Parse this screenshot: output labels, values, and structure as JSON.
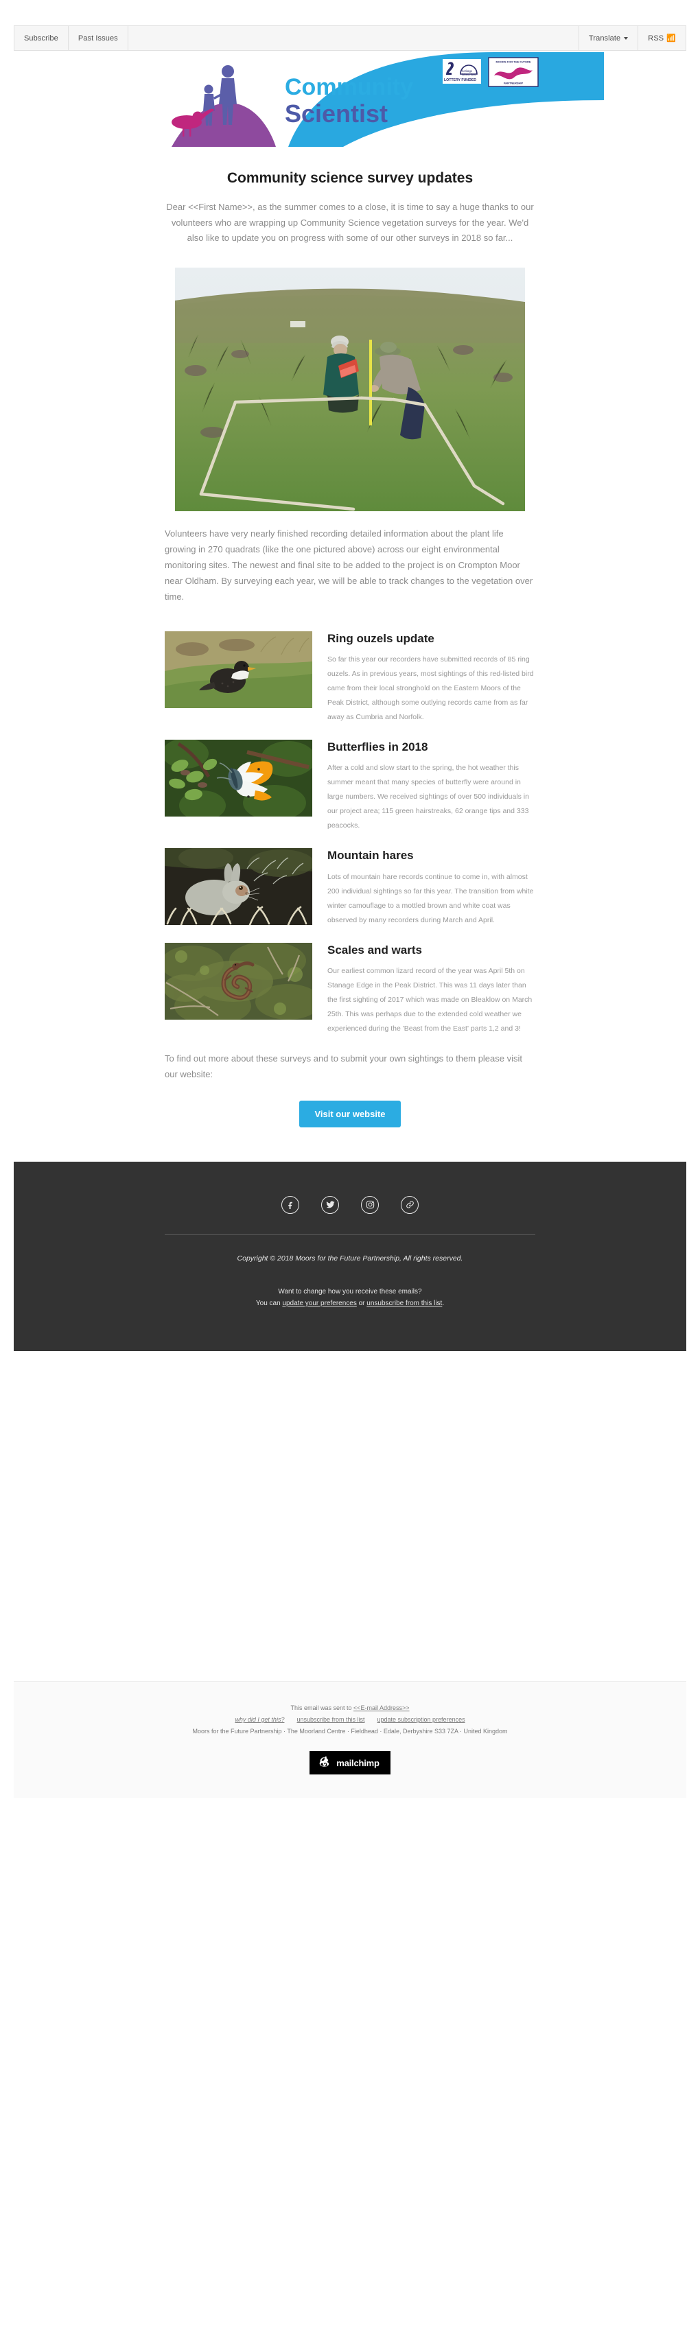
{
  "awesomebar": {
    "subscribe": "Subscribe",
    "past_issues": "Past Issues",
    "translate": "Translate",
    "rss": "RSS"
  },
  "logo": {
    "line1": "Community",
    "line2": "Scientist",
    "badge_lottery": "LOTTERY FUNDED",
    "badge_lottery_name": "heritage lottery fund",
    "badge_moors_top": "MOORS FOR THE FUTURE",
    "badge_moors_bottom": "PARTNERSHIP",
    "colors": {
      "swoosh": "#29a8e0",
      "community": "#2bace2",
      "scientist": "#4d5aa8",
      "bird": "#c0267e",
      "people": "#5b5ea9",
      "hill": "#8e4a9e"
    }
  },
  "main": {
    "title": "Community science survey updates",
    "intro": "Dear <<First Name>>, as the summer comes to a close, it is time to say a huge thanks to our volunteers who are wrapping up Community Science vegetation surveys for the year. We'd also like to update you on progress with some of our other surveys in 2018 so far...",
    "hero_alt": "Two volunteers recording plant life inside a quadrat on moorland grassland",
    "body_copy": "Volunteers have very nearly finished recording detailed information about the plant life growing in 270 quadrats (like the one pictured above) across our eight environmental monitoring sites. The newest and final site to be added to the project is on Crompton Moor near Oldham. By surveying each year, we will be able to track changes to the vegetation over time.",
    "outro": "To find out more about these surveys and to submit your own sightings to them please visit our website:",
    "cta_label": "Visit our website",
    "cta_color": "#2bace2"
  },
  "articles": [
    {
      "title": "Ring ouzels update",
      "body": "So far this year our recorders have submitted records of 85 ring ouzels.  As in previous years, most sightings of this red-listed bird came from their local stronghold on the Eastern Moors of the Peak District, although some outlying records came from as far away as Cumbria and Norfolk.",
      "image_alt": "Ring ouzel bird with white crescent on breast standing on grass"
    },
    {
      "title": "Butterflies in 2018",
      "body": "After a cold and slow start to the spring, the hot weather this summer meant that many species of butterfly were around in large numbers. We received sightings of over 500 individuals in our project area; 115 green hairstreaks, 62 orange tips and 333 peacocks.",
      "image_alt": "Orange tip butterfly with white and orange wings resting on green leaves"
    },
    {
      "title": "Mountain hares",
      "body": "Lots of mountain hare records continue to come in, with almost 200 individual sightings so far this year. The transition from white winter camouflage to a mottled brown and white coat was observed by many recorders during March and April.",
      "image_alt": "Mountain hare in pale winter coat sitting amongst frosted heather"
    },
    {
      "title": "Scales and warts",
      "body": "Our earliest common lizard record of the year was April 5th on Stanage Edge in the Peak District. This was 11 days later than the first sighting of 2017 which was made on Bleaklow on March 25th. This was perhaps due to the extended cold weather we experienced during the 'Beast from the East' parts 1,2 and 3!",
      "image_alt": "Common lizard curled on a bed of moss and heather"
    }
  ],
  "footer": {
    "social": [
      {
        "name": "facebook-icon",
        "label": "Facebook"
      },
      {
        "name": "twitter-icon",
        "label": "Twitter"
      },
      {
        "name": "instagram-icon",
        "label": "Instagram"
      },
      {
        "name": "link-icon",
        "label": "Website"
      }
    ],
    "copyright": "Copyright © 2018 Moors for the Future Partnership, All rights reserved.",
    "pref_question": "Want to change how you receive these emails?",
    "pref_prefix": "You can ",
    "pref_link1": "update your preferences",
    "pref_middle": " or ",
    "pref_link2": "unsubscribe from this list",
    "pref_suffix": ".",
    "background": "#333333"
  },
  "mailchimp_footer": {
    "sent_prefix": "This email was sent to ",
    "sent_address": "<<E-mail Address>>",
    "link_why": "why did I get this?",
    "link_unsubscribe": "unsubscribe from this list",
    "link_update": "update subscription preferences",
    "address": "Moors for the Future Partnership · The Moorland Centre · Fieldhead · Edale, Derbyshire S33 7ZA · United Kingdom",
    "badge_text": "mailchimp"
  }
}
